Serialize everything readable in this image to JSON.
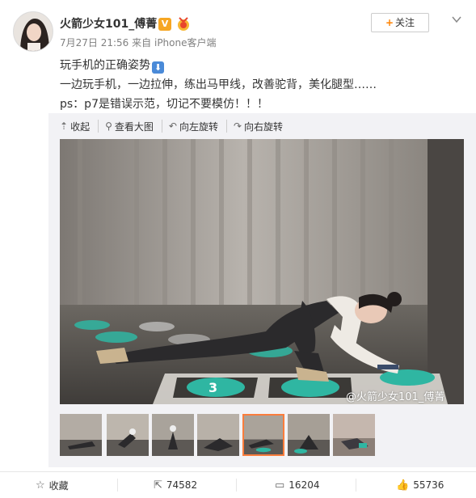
{
  "post": {
    "username": "火箭少女101_傅菁",
    "v_badge": "V",
    "date": "7月27日 21:56",
    "via": "来自",
    "source": "iPhone客户端",
    "follow_label": "关注",
    "follow_plus": "+",
    "text_line1": "玩手机的正确姿势",
    "text_line2": "一边玩手机，一边拉伸，练出马甲线，改善驼背，美化腿型……",
    "text_line3": "ps：p7是错误示范，切记不要模仿！！！"
  },
  "toolbar": {
    "collapse": "收起",
    "view_large": "查看大图",
    "rotate_left": "向左旋转",
    "rotate_right": "向右旋转"
  },
  "photo": {
    "watermark": "@火箭少女101_傅菁"
  },
  "actions": {
    "favorite": "收藏",
    "repost_count": "74582",
    "comment_count": "16204",
    "like_count": "55736"
  },
  "colors": {
    "accent": "#ff8200",
    "active_thumb_border": "#fa7d3c",
    "teal": "#2fb6a2"
  },
  "icons": {
    "collapse": "arrow-up-icon",
    "view": "magnifier-icon",
    "rotate_left": "rotate-left-icon",
    "rotate_right": "rotate-right-icon",
    "favorite": "star-icon",
    "repost": "share-icon",
    "comment": "comment-icon",
    "like": "thumb-up-icon",
    "more": "chevron-down-icon"
  }
}
